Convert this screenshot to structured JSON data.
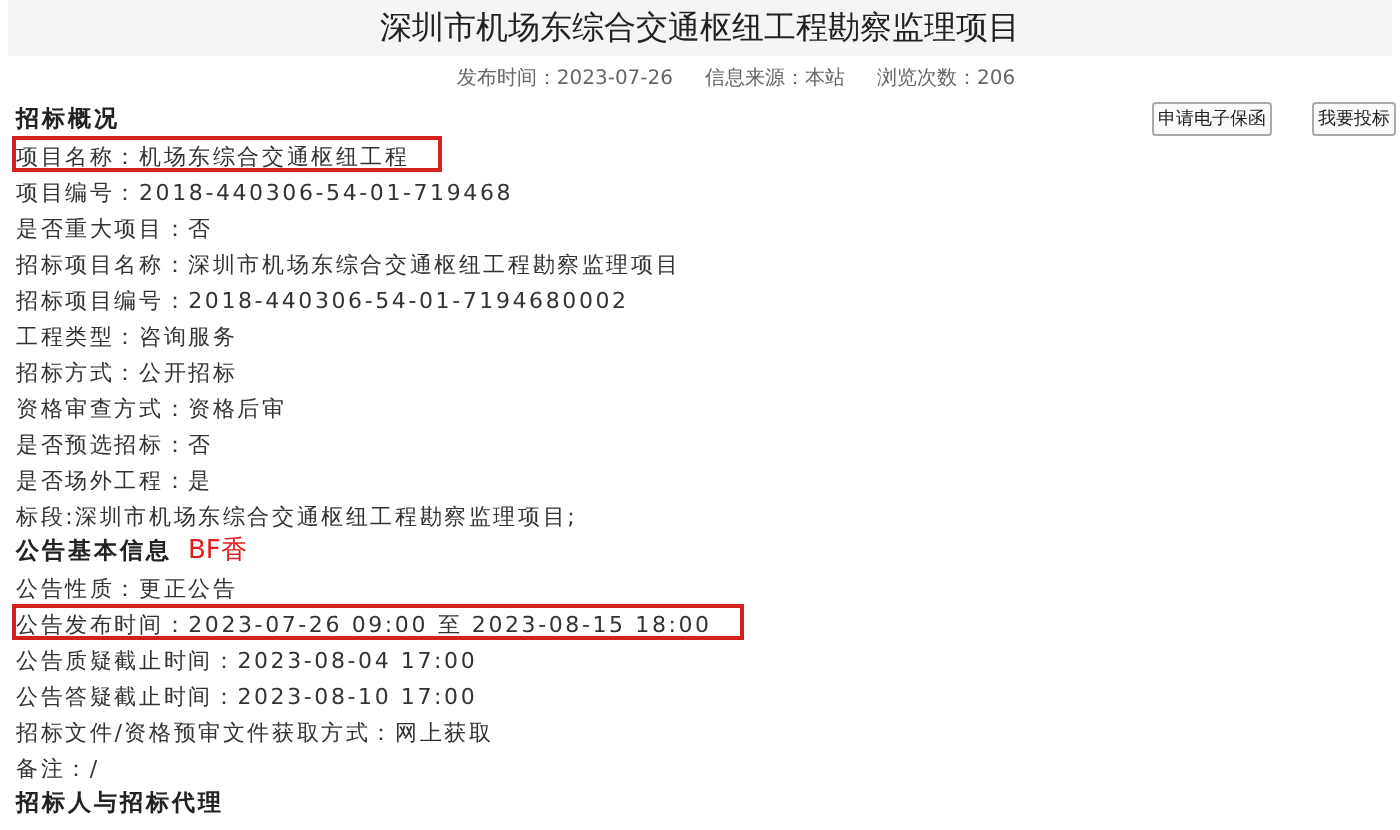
{
  "title": "深圳市机场东综合交通枢纽工程勘察监理项目",
  "meta": [
    "发布时间：2023-07-26",
    "信息来源：本站",
    "浏览次数：206"
  ],
  "buttons": [
    "申请电子保函",
    "我要投标"
  ],
  "sections": [
    {
      "heading": "招标概况",
      "rows": [
        {
          "text": "项目名称：机场东综合交通枢纽工程",
          "highlighted": true
        },
        {
          "text": "项目编号：2018-440306-54-01-719468",
          "highlighted": false
        },
        {
          "text": "是否重大项目：否",
          "highlighted": false
        },
        {
          "text": "招标项目名称：深圳市机场东综合交通枢纽工程勘察监理项目",
          "highlighted": false
        },
        {
          "text": "招标项目编号：2018-440306-54-01-7194680002",
          "highlighted": false
        },
        {
          "text": "工程类型：咨询服务",
          "highlighted": false
        },
        {
          "text": "招标方式：公开招标",
          "highlighted": false
        },
        {
          "text": "资格审查方式：资格后审",
          "highlighted": false
        },
        {
          "text": "是否预选招标：否",
          "highlighted": false
        },
        {
          "text": "是否场外工程：是",
          "highlighted": false
        },
        {
          "text": "标段:深圳市机场东综合交通枢纽工程勘察监理项目;",
          "highlighted": false
        }
      ]
    },
    {
      "heading": "公告基本信息",
      "annotation": "BF香",
      "rows": [
        {
          "text": "公告性质：更正公告",
          "highlighted": false
        },
        {
          "text": "公告发布时间：2023-07-26 09:00 至 2023-08-15 18:00",
          "highlighted": true
        },
        {
          "text": "公告质疑截止时间：2023-08-04 17:00",
          "highlighted": false
        },
        {
          "text": "公告答疑截止时间：2023-08-10 17:00",
          "highlighted": false
        },
        {
          "text": "招标文件/资格预审文件获取方式：网上获取",
          "highlighted": false
        },
        {
          "text": "备注：/",
          "highlighted": false
        }
      ]
    },
    {
      "heading": "招标人与招标代理"
    }
  ]
}
